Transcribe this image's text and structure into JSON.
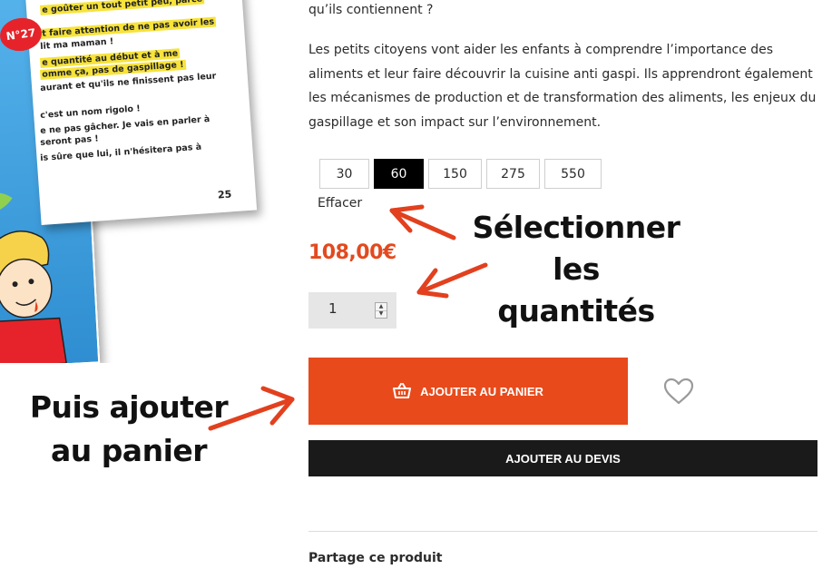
{
  "booklet": {
    "issue_badge": "N°27",
    "page_number": "25",
    "lines": [
      {
        "text": "e goûter un tout petit peu, parce",
        "highlight": true
      },
      {
        "text": "t faire attention de ne pas avoir les",
        "highlight": true
      },
      {
        "text": "lit ma maman !",
        "highlight": false
      },
      {
        "text": "e quantité au début et à me",
        "highlight": true
      },
      {
        "text": "omme ça, pas de gaspillage !",
        "highlight": true
      },
      {
        "text": "aurant et qu'ils ne finissent pas leur",
        "highlight": false
      },
      {
        "text": "c'est un nom rigolo !",
        "highlight": false
      },
      {
        "text": "e ne pas gâcher. Je vais en parler à",
        "highlight": false
      },
      {
        "text": "seront pas !",
        "highlight": false
      },
      {
        "text": "is sûre que lui, il n'hésitera pas à",
        "highlight": false
      }
    ]
  },
  "product": {
    "intro_tail": "qu’ils contiennent ?",
    "description": "Les petits citoyens vont aider les enfants à comprendre l’importance des aliments et leur faire découvrir la cuisine anti gaspi. Ils apprendront également les mécanismes de production et de transformation des aliments, les enjeux du gaspillage et son impact sur l’environnement.",
    "quantity_options": [
      {
        "label": "30",
        "selected": false
      },
      {
        "label": "60",
        "selected": true
      },
      {
        "label": "150",
        "selected": false
      },
      {
        "label": "275",
        "selected": false
      },
      {
        "label": "550",
        "selected": false
      }
    ],
    "clear_label": "Effacer",
    "price": "108,00€",
    "quantity_value": "1",
    "add_to_cart_label": "AJOUTER AU PANIER",
    "add_to_quote_label": "AJOUTER AU DEVIS",
    "share_label": "Partage ce produit"
  },
  "annotations": {
    "select_quantities": [
      "Sélectionner les",
      "quantités"
    ],
    "add_to_cart": [
      "Puis ajouter",
      "au panier"
    ]
  },
  "colors": {
    "accent_orange": "#e84a1b",
    "price_orange": "#e24a1f",
    "arrow_red": "#e2401e",
    "dark_button": "#1a1a1a",
    "booklet_blue": "#3a9be0",
    "highlight_yellow": "#f7e33a"
  },
  "icons": {
    "cart": "basket-icon",
    "wishlist": "heart-outline-icon",
    "stepper_up": "caret-up-icon",
    "stepper_down": "caret-down-icon"
  }
}
